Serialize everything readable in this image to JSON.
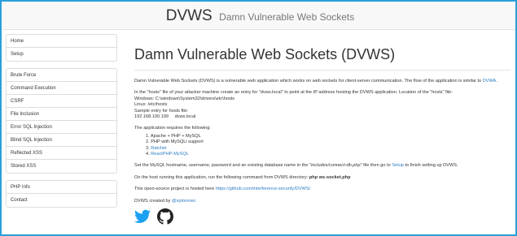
{
  "header": {
    "brand": "DVWS",
    "subtitle": "Damn Vulnerable Web Sockets"
  },
  "sidebar": {
    "group1": [
      "Home",
      "Setup"
    ],
    "group2": [
      "Brute Force",
      "Command Execution",
      "CSRF",
      "File Inclusion",
      "Error SQL Injection",
      "Blind SQL Injection",
      "Reflected XSS",
      "Stored XSS"
    ],
    "group3": [
      "PHP Info",
      "Contact"
    ]
  },
  "main": {
    "title": "Damn Vulnerable Web Sockets (DVWS)",
    "intro": "Damn Vulnerable Web Sockets (DVWS) is a vulnerable web application which works on web sockets for client-server communication. The flow of the application is similar to",
    "intro_link": "DVWA",
    "intro_end": ".",
    "hosts_line": "In the \"hosts\" file of your attacker machine create an entry for \"dvws.local\" to point at the IP address hosting the DVWS application. Location of the \"hosts\" file:",
    "windows_path": "Windows: C:\\windows\\System32\\drivers\\etc\\hosts",
    "linux_path": "Linux: /etc/hosts",
    "sample_label": "Sample entry for hosts file:",
    "sample_ip": "192.168.100.199",
    "sample_host": "dvws.local",
    "requires_intro": "The application requires the following:",
    "requirements": [
      {
        "text": "Apache + PHP + MySQL",
        "link": false
      },
      {
        "text": "PHP with MySQLi support",
        "link": false
      },
      {
        "text": "Ratchet",
        "link": true
      },
      {
        "text": "ReactPHP-MySQL",
        "link": true
      }
    ],
    "setup_pre": "Set the MySQL hostname, username, password and an existing database name in the \"",
    "setup_file": "includes/connect-db.php",
    "setup_mid": "\" file then go to",
    "setup_link": "Setup",
    "setup_post": "to finish setting up DVWS.",
    "run_pre": "On the host running this application, run the following command from DVWS directory:",
    "run_cmd": "php ws-socket.php",
    "opensource_pre": "This open-source project is hosted here",
    "opensource_link": "https://github.com/interference-security/DVWS/",
    "created_pre": "DVWS created by",
    "created_link": "@xploresec"
  },
  "icons": {
    "twitter": "twitter-icon",
    "github": "github-icon"
  },
  "colors": {
    "link": "#2b7cc4",
    "border": "#2aa0d8",
    "twitter": "#1da1f2"
  }
}
